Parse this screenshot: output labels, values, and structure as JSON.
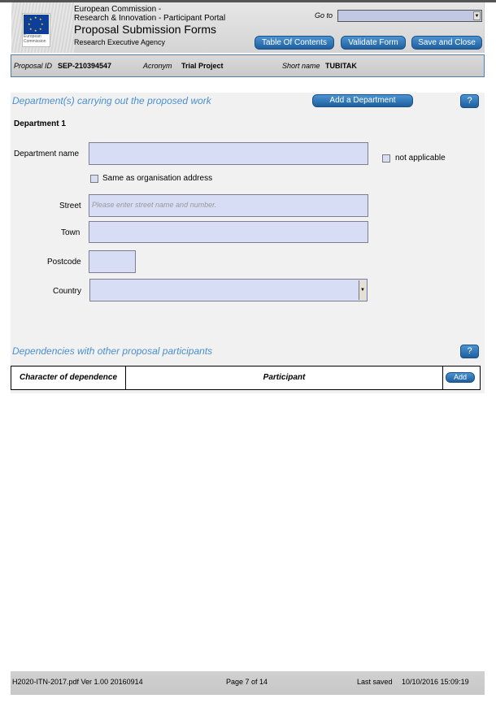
{
  "header": {
    "org_line1": "European Commission -",
    "org_line2": "Research & Innovation - Participant Portal",
    "title": "Proposal Submission Forms",
    "agency": "Research Executive Agency",
    "logo_text": "European Commission",
    "goto_label": "Go to",
    "goto_value": "",
    "buttons": {
      "toc": "Table Of Contents",
      "validate": "Validate Form",
      "save_close": "Save and Close"
    }
  },
  "id_bar": {
    "proposal_id_label": "Proposal ID",
    "proposal_id": "SEP-210394547",
    "acronym_label": "Acronym",
    "acronym": "Trial Project",
    "short_name_label": "Short name",
    "short_name": "TUBITAK"
  },
  "departments": {
    "section_title": "Department(s) carrying out the proposed work",
    "add_button": "Add a Department",
    "help": "?",
    "department_heading": "Department 1",
    "fields": {
      "department_name": {
        "label": "Department name",
        "value": ""
      },
      "not_applicable": {
        "label": "not applicable",
        "checked": false
      },
      "same_as_org": {
        "label": "Same as organisation address",
        "checked": false
      },
      "street": {
        "label": "Street",
        "value": "",
        "placeholder": "Please enter street name and number."
      },
      "town": {
        "label": "Town",
        "value": ""
      },
      "postcode": {
        "label": "Postcode",
        "value": ""
      },
      "country": {
        "label": "Country",
        "value": ""
      }
    }
  },
  "dependencies": {
    "section_title": "Dependencies with other proposal participants",
    "help": "?",
    "columns": [
      "Character of dependence",
      "Participant"
    ],
    "add_button": "Add",
    "rows": []
  },
  "footer": {
    "file": "H2020-ITN-2017.pdf Ver 1.00 20160914",
    "page": "Page 7 of 14",
    "last_saved_label": "Last saved",
    "last_saved": "10/10/2016 15:09:19"
  },
  "icons": {
    "dropdown_arrow": "▼",
    "eu_star": "★"
  }
}
